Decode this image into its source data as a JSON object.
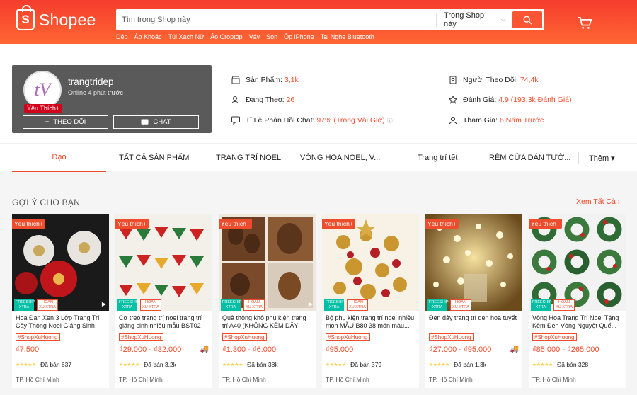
{
  "header": {
    "logo_text": "Shopee",
    "search_placeholder": "Tìm trong Shop này",
    "search_scope": "Trong Shop này",
    "suggestions": [
      "Dép",
      "Áo Khoác",
      "Túi Xách Nữ",
      "Áo Croptop",
      "Váy",
      "Son",
      "Ốp iPhone",
      "Tai Nghe Bluetooth"
    ],
    "brand_color": "#ee4d2d"
  },
  "shop": {
    "avatar_text": "tV",
    "name": "trangtridep",
    "online": "Online 4 phút trước",
    "badge": "Yêu Thích+",
    "follow_label": "THEO DÕI",
    "chat_label": "CHAT",
    "stats": [
      {
        "icon": "store-icon",
        "label": "Sản Phẩm:",
        "value": "3,1k"
      },
      {
        "icon": "user-follow-icon",
        "label": "Đang Theo:",
        "value": "26"
      },
      {
        "icon": "chat-bubble-icon",
        "label": "Tỉ Lệ Phản Hồi Chat:",
        "value": "97% (Trong Vài Giờ)"
      },
      {
        "icon": "followers-icon",
        "label": "Người Theo Dõi:",
        "value": "74,4k"
      },
      {
        "icon": "star-icon",
        "label": "Đánh Giá:",
        "value": "4.9 (193,3k Đánh Giá)"
      },
      {
        "icon": "joined-icon",
        "label": "Tham Gia:",
        "value": "6 Năm Trước"
      }
    ]
  },
  "tabs": [
    "Dạo",
    "TẤT CẢ SẢN PHẨM",
    "TRANG TRÍ NOEL",
    "VÒNG HOA NOEL, V...",
    "Trang trí tết",
    "RÈM CỬA DÁN TƯỜ...",
    "Thêm ▾"
  ],
  "section": {
    "title": "GỢI Ý CHO BẠN",
    "see_all": "Xem Tất Cả"
  },
  "product_labels": {
    "fav": "Yêu thích+",
    "freeship": "FREESHIP XTRA",
    "hoanxu": "HOÀN XU XTRA",
    "shoptag": "#ShopXuHuong"
  },
  "products": [
    {
      "name": "Hoa Đan Xen 3 Lớp Trang Trí Cây Thông Noel Giáng Sinh",
      "price": "₫7.500",
      "sold": "Đã bán 637",
      "location": "TP. Hồ Chí Minh",
      "video": true,
      "ship_icon": false
    },
    {
      "name": "Cờ treo trang trí noel trang trí giáng sinh nhiều mẫu BST02",
      "price": "₫29.000 - ₫32.000",
      "sold": "Đã bán 3,2k",
      "location": "TP. Hồ Chí Minh",
      "video": false,
      "ship_icon": true
    },
    {
      "name": "Quả thông khô phụ kiện trang trí A40 (KHÔNG KÈM DÂY TREO)",
      "price": "₫1.300 - ₫6.000",
      "sold": "Đã bán 38k",
      "location": "TP. Hồ Chí Minh",
      "video": true,
      "ship_icon": false
    },
    {
      "name": "Bộ phụ kiện trang trí noel nhiều món MẪU B80 38 món màu...",
      "price": "₫95.000",
      "sold": "Đã bán 379",
      "location": "TP. Hồ Chí Minh",
      "video": false,
      "ship_icon": false
    },
    {
      "name": "Đèn dây trang trí đèn hoa tuyết",
      "price": "₫27.000 - ₫95.000",
      "sold": "Đã bán 1,3k",
      "location": "TP. Hồ Chí Minh",
      "video": false,
      "ship_icon": true
    },
    {
      "name": "Vòng Hoa Trang Trí Noel Tặng Kèm Đèn Vòng Nguyệt Quế...",
      "price": "₫85.000 - ₫265.000",
      "sold": "Đã bán 328",
      "location": "TP. Hồ Chí Minh",
      "video": false,
      "ship_icon": false
    }
  ]
}
